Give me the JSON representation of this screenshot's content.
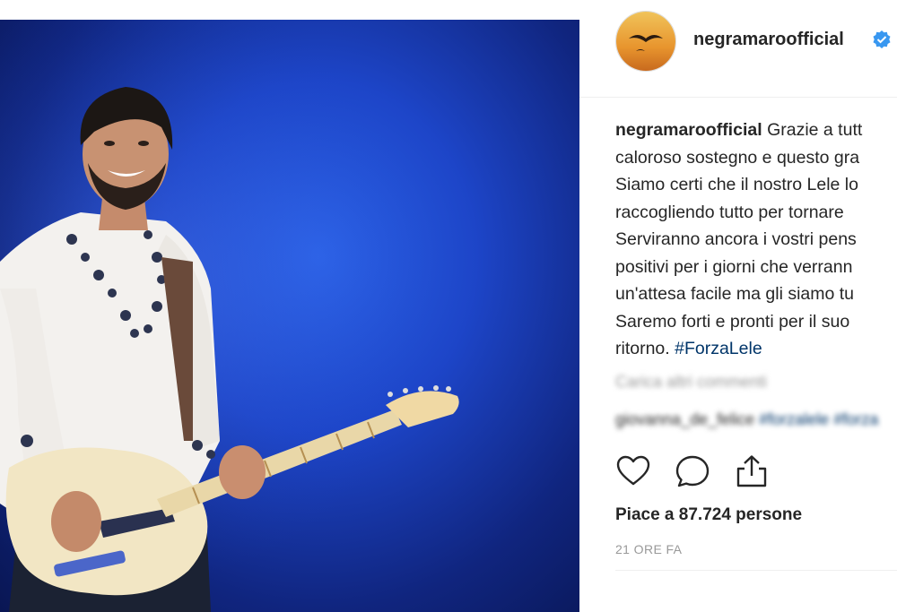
{
  "post": {
    "username": "negramaroofficial",
    "avatar_text": "negramaro",
    "caption_user": "negramaroofficial",
    "caption_lines": [
      "Grazie a tutt",
      "caloroso sostegno e questo gra",
      "Siamo certi che il nostro Lele lo",
      "raccogliendo tutto per tornare",
      "Serviranno ancora i vostri pens",
      "positivi per i giorni che verrann",
      "un'attesa facile ma gli siamo tu",
      "Saremo forti e pronti per il suo",
      "ritorno. "
    ],
    "hashtag": "#ForzaLele",
    "load_more_comments": "Carica altri commenti",
    "comment_user": "giovanna_de_felice",
    "comment_text": "#forzalele #forza",
    "likes_text": "Piace a 87.724 persone",
    "timestamp": "21 ORE FA"
  },
  "icons": {
    "like": "heart-icon",
    "comment": "comment-icon",
    "share": "share-icon",
    "verified": "verified-badge-icon"
  },
  "colors": {
    "verified": "#3897f0",
    "text": "#262626",
    "muted": "#999999",
    "hashtag": "#003569"
  }
}
